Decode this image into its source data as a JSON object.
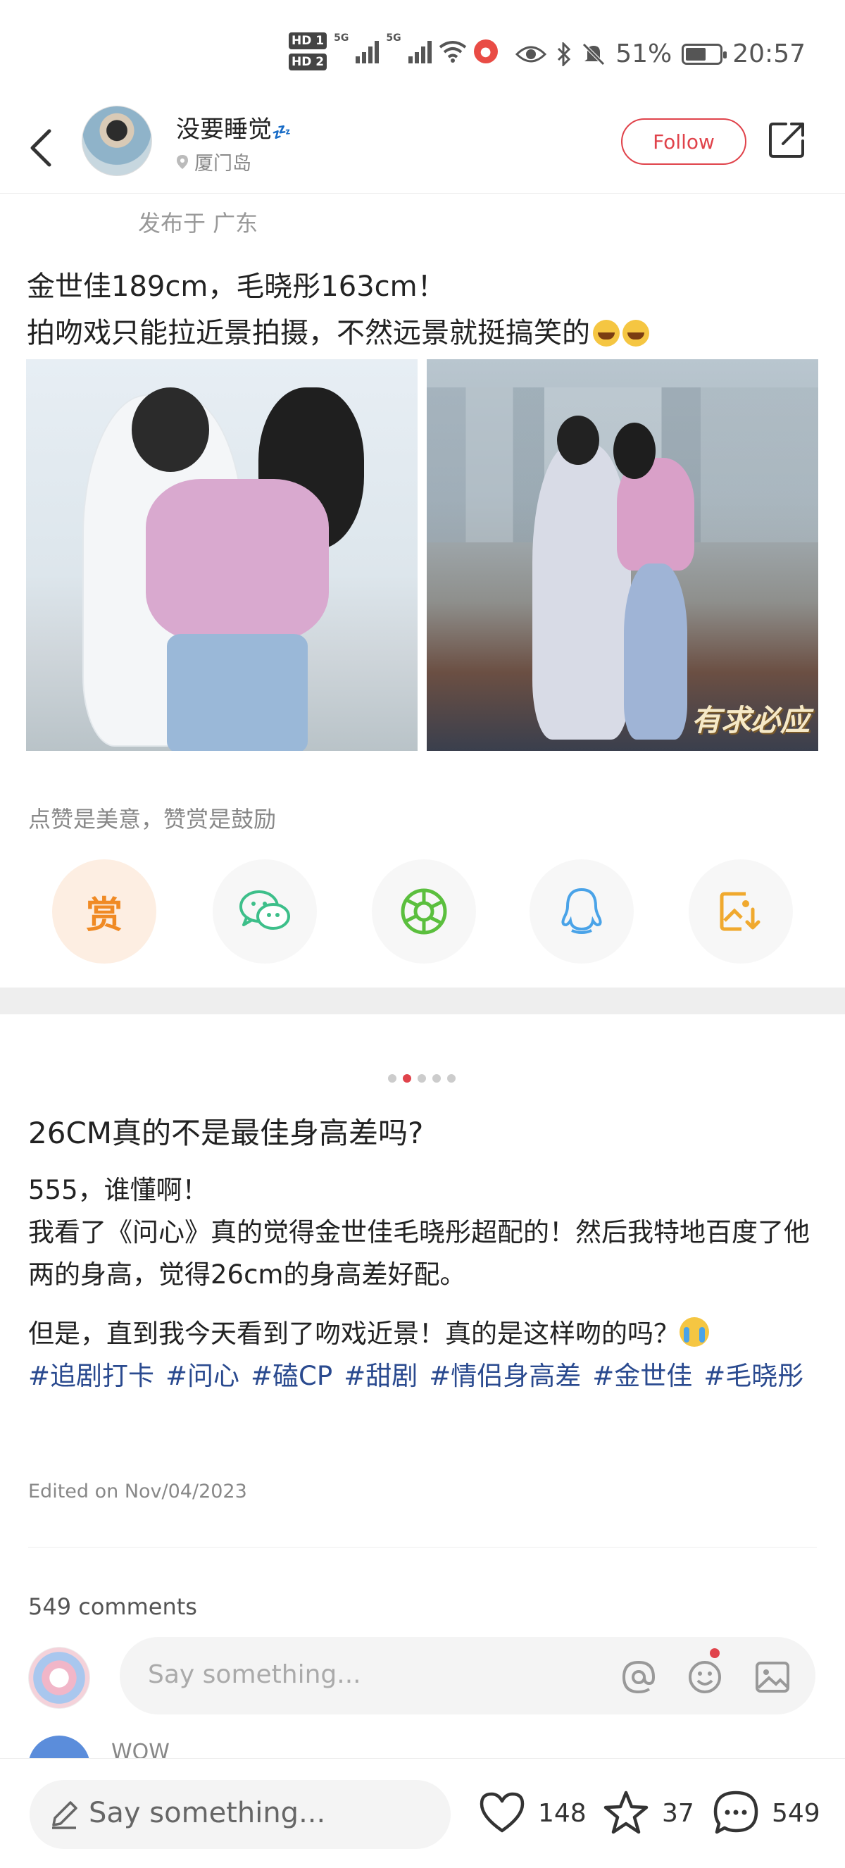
{
  "status_bar": {
    "hd1": "HD 1",
    "hd2": "HD 2",
    "sig1": "5G",
    "sig2": "5G",
    "battery_pct": "51%",
    "time": "20:57",
    "icons": [
      "eye-icon",
      "bluetooth-icon",
      "mute-icon",
      "wifi-icon",
      "record-icon"
    ]
  },
  "header": {
    "username": "没要睡觉",
    "username_suffix": "💤",
    "location": "厦门岛",
    "follow_label": "Follow"
  },
  "post": {
    "publish_location": "发布于 广东",
    "text_line1": "金世佳189cm，毛晓彤163cm！",
    "text_line2": "拍吻戏只能拉近景拍摄，不然远景就挺搞笑的",
    "image2_watermark": "有求必应"
  },
  "reward": {
    "prompt": "点赞是美意，赞赏是鼓励",
    "reward_label": "赏",
    "buttons": [
      "reward-icon",
      "wechat-icon",
      "moments-icon",
      "qq-icon",
      "save-image-icon"
    ]
  },
  "article": {
    "pager_total": 5,
    "pager_active": 2,
    "title": "26CM真的不是最佳身高差吗?",
    "p1_line1": "555，谁懂啊！",
    "p1_line2": "我看了《问心》真的觉得金世佳毛晓彤超配的！然后我特地百度了他两的身高，觉得26cm的身高差好配。",
    "p2": "但是，直到我今天看到了吻戏近景！真的是这样吻的吗？",
    "tags": [
      "#追剧打卡",
      "#问心",
      "#磕CP",
      "#甜剧",
      "#情侣身高差",
      "#金世佳",
      "#毛晓彤"
    ],
    "edited": "Edited on  Nov/04/2023"
  },
  "comments": {
    "count_label": "549 comments",
    "input_placeholder": "Say something...",
    "next_comment_name": "WOW"
  },
  "bottom_bar": {
    "input_placeholder": "Say something...",
    "likes": "148",
    "favorites": "37",
    "comments": "549"
  },
  "colors": {
    "accent": "#e0434b",
    "tag_blue": "#2a4a8f",
    "reward_orange": "#f08a24",
    "wechat_green": "#3dbf8a",
    "qq_blue": "#4aa3e8"
  }
}
